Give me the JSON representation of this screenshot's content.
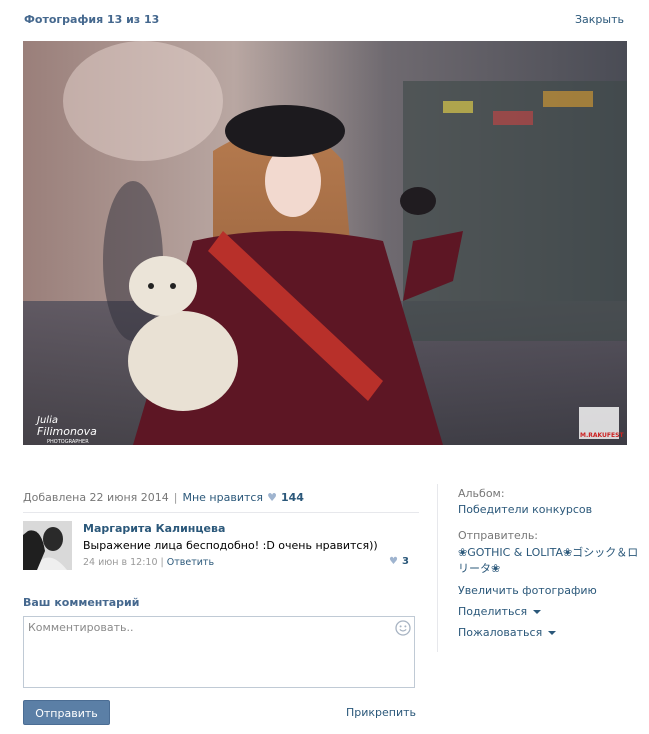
{
  "header": {
    "title": "Фотография 13 из 13",
    "close_label": "Закрыть"
  },
  "photo": {
    "watermark_left_1": "Julia",
    "watermark_left_2": "Filimonova",
    "watermark_left_3": "PHOTOGRAPHER",
    "watermark_right": "M.RAKUFEST"
  },
  "info": {
    "added": "Добавлена 22 июня 2014",
    "like_label": "Мне нравится",
    "like_count": "144"
  },
  "comment": {
    "author": "Маргарита Калинцева",
    "text": "Выражение лица бесподобно! :D очень нравится))",
    "date": "24 июн в 12:10",
    "reply_label": "Ответить",
    "likes": "3"
  },
  "compose": {
    "heading": "Ваш комментарий",
    "placeholder": "Комментировать..",
    "send_label": "Отправить",
    "attach_label": "Прикрепить"
  },
  "sidebar": {
    "album_label": "Альбом:",
    "album_name": "Победители конкурсов",
    "sender_label": "Отправитель:",
    "sender_name_1": "❀GOTHIC & LOLITA❀ゴシック＆ロ",
    "sender_name_2": "リータ❀",
    "enlarge": "Увеличить фотографию",
    "share": "Поделиться",
    "report": "Пожаловаться"
  },
  "colors": {
    "link": "#2b587a",
    "heading": "#45688e",
    "button": "#5b7fa6"
  }
}
